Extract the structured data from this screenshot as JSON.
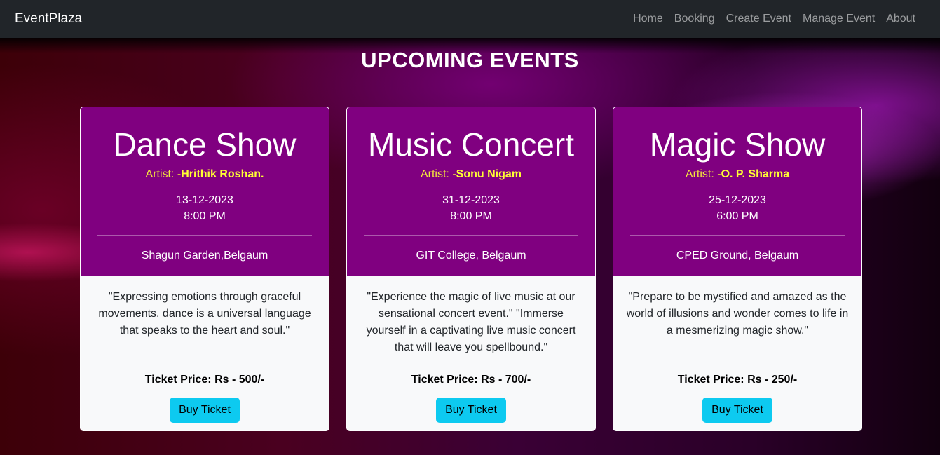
{
  "navbar": {
    "brand": "EventPlaza",
    "links": [
      "Home",
      "Booking",
      "Create Event",
      "Manage Event",
      "About"
    ]
  },
  "page": {
    "title": "UPCOMING EVENTS"
  },
  "events": [
    {
      "title": "Dance Show",
      "artist_prefix": "Artist: -",
      "artist": "Hrithik Roshan.",
      "date": "13-12-2023",
      "time": "8:00 PM",
      "venue": "Shagun Garden,Belgaum",
      "description": "\"Expressing emotions through graceful movements, dance is a universal language that speaks to the heart and soul.\"",
      "price": "Ticket Price: Rs - 500/-",
      "button": "Buy Ticket"
    },
    {
      "title": "Music Concert",
      "artist_prefix": "Artist: -",
      "artist": "Sonu Nigam",
      "date": "31-12-2023",
      "time": "8:00 PM",
      "venue": "GIT College, Belgaum",
      "description": "\"Experience the magic of live music at our sensational concert event.\" \"Immerse yourself in a captivating live music concert that will leave you spellbound.\"",
      "price": "Ticket Price: Rs - 700/-",
      "button": "Buy Ticket"
    },
    {
      "title": "Magic Show",
      "artist_prefix": "Artist: -",
      "artist": "O. P. Sharma",
      "date": "25-12-2023",
      "time": "6:00 PM",
      "venue": "CPED Ground, Belgaum",
      "description": "\"Prepare to be mystified and amazed as the world of illusions and wonder comes to life in a mesmerizing magic show.\"",
      "price": "Ticket Price: Rs - 250/-",
      "button": "Buy Ticket"
    }
  ],
  "colors": {
    "navbar_bg": "#212529",
    "card_header_bg": "#800080",
    "artist_text": "#ffff33",
    "button_bg": "#0dcaf0"
  }
}
